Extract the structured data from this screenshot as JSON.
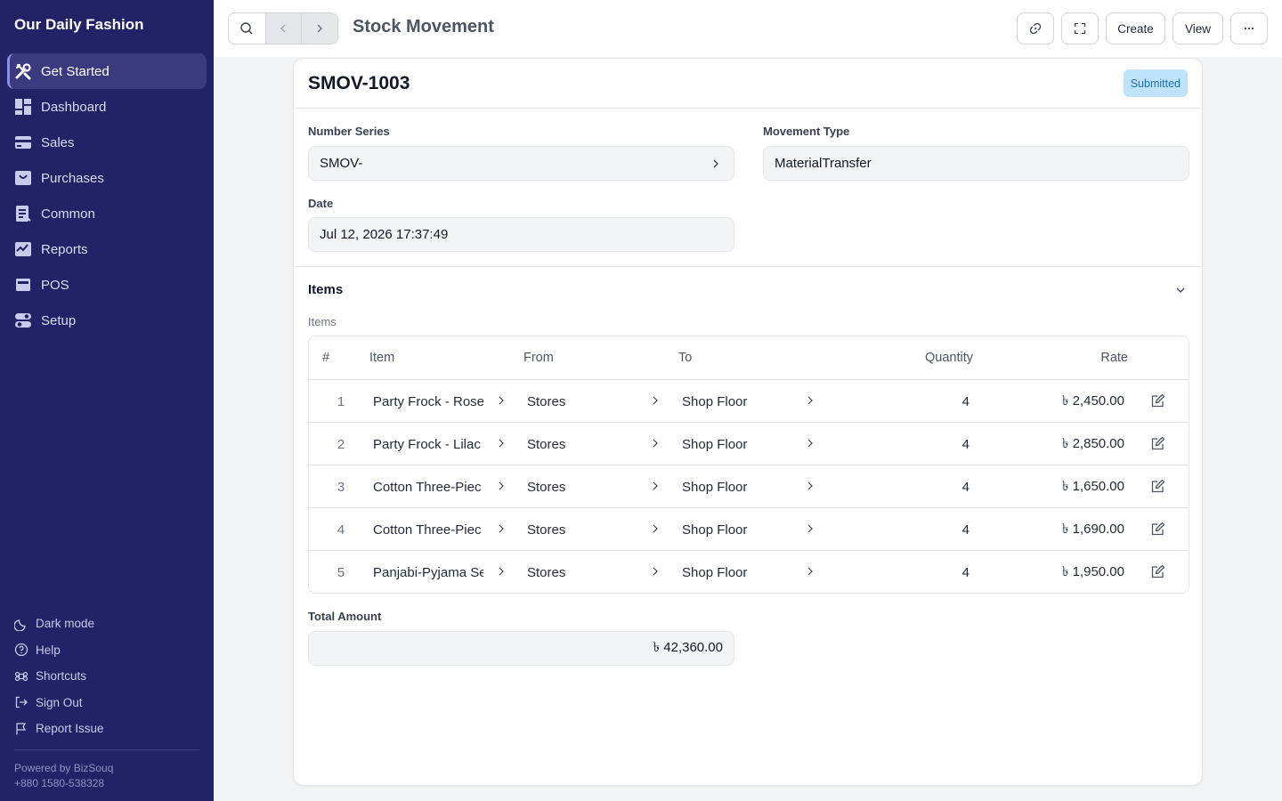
{
  "app": {
    "name": "Our Daily Fashion"
  },
  "sidebar": {
    "items": [
      {
        "label": "Get Started",
        "icon": "tools-icon",
        "active": true
      },
      {
        "label": "Dashboard",
        "icon": "dashboard-icon"
      },
      {
        "label": "Sales",
        "icon": "sales-icon"
      },
      {
        "label": "Purchases",
        "icon": "purchases-icon"
      },
      {
        "label": "Common",
        "icon": "common-icon"
      },
      {
        "label": "Reports",
        "icon": "reports-icon"
      },
      {
        "label": "POS",
        "icon": "pos-icon"
      },
      {
        "label": "Setup",
        "icon": "setup-icon"
      }
    ],
    "bottom": [
      {
        "label": "Dark mode",
        "icon": "moon-icon"
      },
      {
        "label": "Help",
        "icon": "help-icon"
      },
      {
        "label": "Shortcuts",
        "icon": "command-icon"
      },
      {
        "label": "Sign Out",
        "icon": "sign-out-icon"
      },
      {
        "label": "Report Issue",
        "icon": "flag-icon"
      }
    ],
    "powered_by": "Powered by BizSouq",
    "phone": "+880 1580-538328"
  },
  "header": {
    "title": "Stock Movement",
    "create_label": "Create",
    "view_label": "View"
  },
  "document": {
    "name": "SMOV-1003",
    "status": "Submitted",
    "number_series_label": "Number Series",
    "number_series": "SMOV-",
    "movement_type_label": "Movement Type",
    "movement_type": "MaterialTransfer",
    "date_label": "Date",
    "date": "Jul 12, 2026 17:37:49",
    "items_section": "Items",
    "items_sub_label": "Items",
    "total_label": "Total Amount",
    "total": "৳ 42,360.00"
  },
  "table": {
    "columns": [
      "#",
      "Item",
      "From",
      "To",
      "Quantity",
      "Rate"
    ],
    "rows": [
      {
        "idx": "1",
        "item": "Party Frock - Rose",
        "from": "Stores",
        "to": "Shop Floor",
        "qty": "4",
        "rate": "৳ 2,450.00"
      },
      {
        "idx": "2",
        "item": "Party Frock - Lilac",
        "from": "Stores",
        "to": "Shop Floor",
        "qty": "4",
        "rate": "৳ 2,850.00"
      },
      {
        "idx": "3",
        "item": "Cotton Three-Piec",
        "from": "Stores",
        "to": "Shop Floor",
        "qty": "4",
        "rate": "৳ 1,650.00"
      },
      {
        "idx": "4",
        "item": "Cotton Three-Piec",
        "from": "Stores",
        "to": "Shop Floor",
        "qty": "4",
        "rate": "৳ 1,690.00"
      },
      {
        "idx": "5",
        "item": "Panjabi-Pyjama Se",
        "from": "Stores",
        "to": "Shop Floor",
        "qty": "4",
        "rate": "৳ 1,950.00"
      }
    ]
  },
  "colors": {
    "sidebar_bg": "#232266",
    "status_badge_bg": "#bfe3fb",
    "status_badge_text": "#1d6fb1"
  }
}
